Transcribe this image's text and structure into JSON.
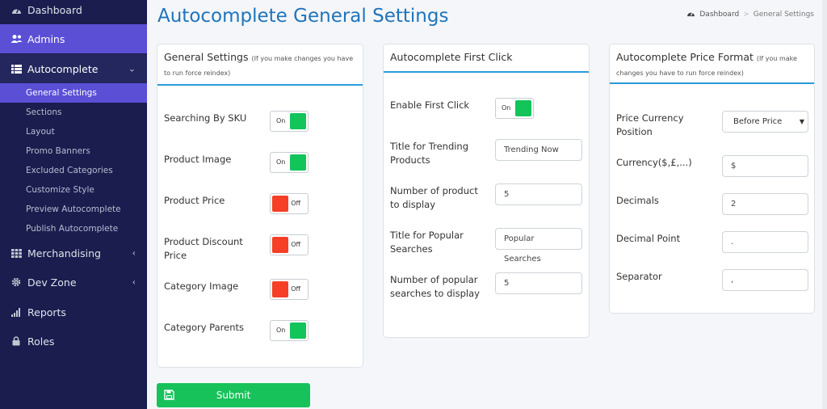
{
  "sidebar": {
    "dashboard": "Dashboard",
    "admins": "Admins",
    "autocomplete": "Autocomplete",
    "sub": [
      "General Settings",
      "Sections",
      "Layout",
      "Promo Banners",
      "Excluded Categories",
      "Customize Style",
      "Preview Autocomplete",
      "Publish Autocomplete"
    ],
    "merchandising": "Merchandising",
    "devzone": "Dev Zone",
    "reports": "Reports",
    "roles": "Roles"
  },
  "header": {
    "title": "Autocomplete General Settings",
    "breadcrumb_home": "Dashboard",
    "breadcrumb_sep": ">",
    "breadcrumb_current": "General Settings"
  },
  "general": {
    "title": "General Settings",
    "note": "(If you make changes you have to run force reindex)",
    "rows": [
      {
        "label": "Searching By SKU",
        "state": "On"
      },
      {
        "label": "Product Image",
        "state": "On"
      },
      {
        "label": "Product Price",
        "state": "Off"
      },
      {
        "label": "Product Discount Price",
        "state": "Off"
      },
      {
        "label": "Category Image",
        "state": "Off"
      },
      {
        "label": "Category Parents",
        "state": "On"
      }
    ]
  },
  "firstclick": {
    "title": "Autocomplete First Click",
    "enable_label": "Enable First Click",
    "enable_state": "On",
    "trending_label": "Title for Trending Products",
    "trending_value": "Trending Now",
    "num_product_label": "Number of product to display",
    "num_product_value": "5",
    "popular_label": "Title for Popular Searches",
    "popular_value": "Popular Searches",
    "num_popular_label": "Number of popular searches to display",
    "num_popular_value": "5"
  },
  "price": {
    "title": "Autocomplete Price Format",
    "note": "(If you make changes you have to run force reindex)",
    "position_label": "Price Currency Position",
    "position_value": "Before Price",
    "currency_label": "Currency($,£,...)",
    "currency_value": "$",
    "decimals_label": "Decimals",
    "decimals_value": "2",
    "point_label": "Decimal Point",
    "point_value": ".",
    "separator_label": "Separator",
    "separator_value": ","
  },
  "submit_label": "Submit",
  "colors": {
    "sidebar": "#1a1d4e",
    "active": "#5b4fd6",
    "accent": "#2a9adc",
    "on": "#12c45a",
    "off": "#f53f27",
    "title": "#1f74ba"
  }
}
